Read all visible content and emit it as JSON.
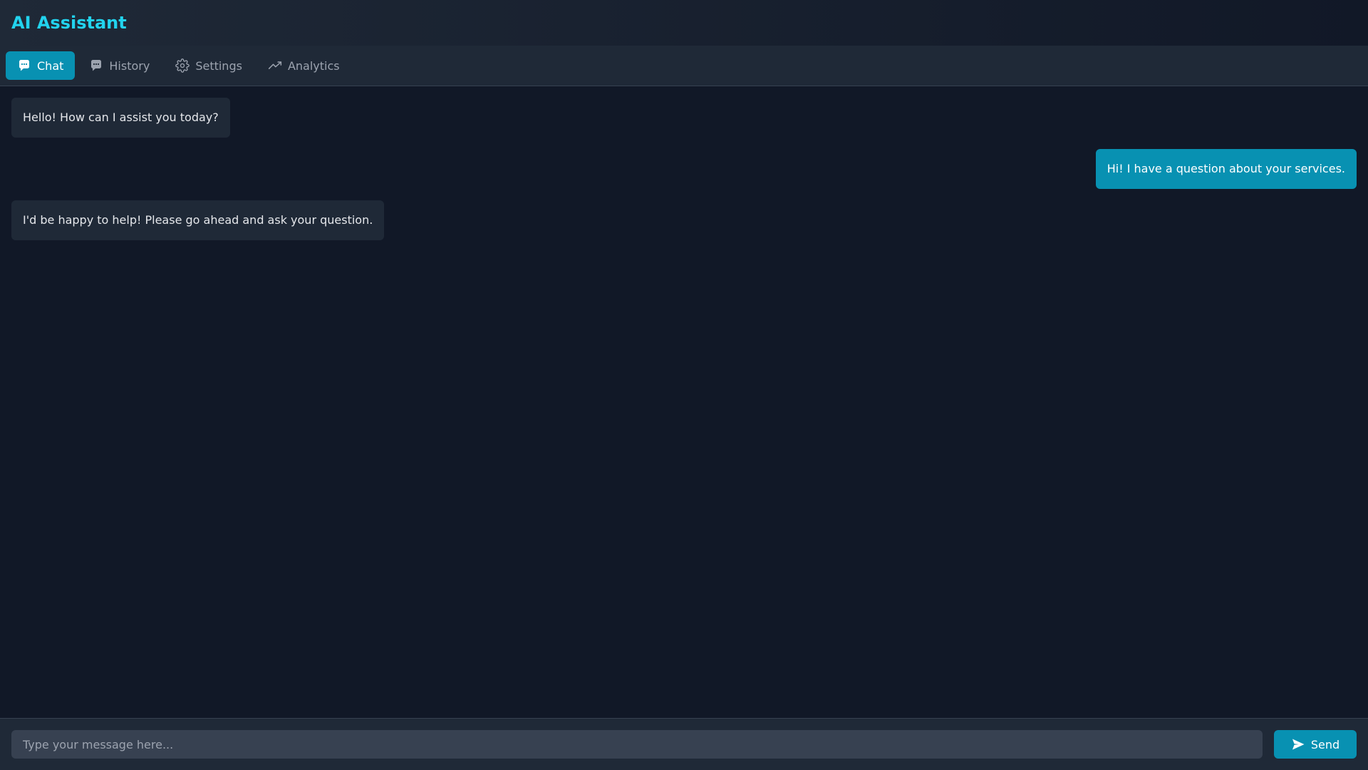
{
  "app": {
    "title": "AI Assistant"
  },
  "colors": {
    "accent": "#0891b2",
    "title": "#22d3ee",
    "background": "#111827",
    "panel": "#1f2937",
    "input": "#374151"
  },
  "tabs": [
    {
      "label": "Chat",
      "icon": "chat-bubble-icon",
      "active": true
    },
    {
      "label": "History",
      "icon": "message-square-icon",
      "active": false
    },
    {
      "label": "Settings",
      "icon": "gear-icon",
      "active": false
    },
    {
      "label": "Analytics",
      "icon": "trend-line-icon",
      "active": false
    }
  ],
  "messages": [
    {
      "role": "assistant",
      "text": "Hello! How can I assist you today?"
    },
    {
      "role": "user",
      "text": "Hi! I have a question about your services."
    },
    {
      "role": "assistant",
      "text": "I'd be happy to help! Please go ahead and ask your question."
    }
  ],
  "composer": {
    "placeholder": "Type your message here...",
    "value": "",
    "send_label": "Send",
    "send_icon": "send-icon"
  }
}
